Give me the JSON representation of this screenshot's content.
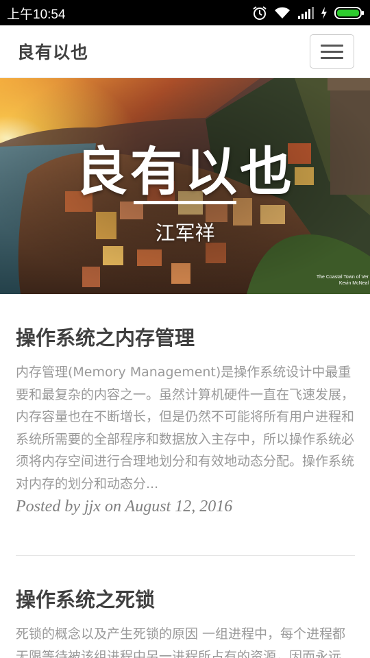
{
  "status_bar": {
    "time": "上午10:54",
    "icons": [
      "alarm-icon",
      "wifi-icon",
      "signal-icon",
      "charging-icon",
      "battery-icon"
    ],
    "battery_color": "#2ecc2e"
  },
  "navbar": {
    "brand": "良有以也",
    "menu_icon": "hamburger-icon"
  },
  "hero": {
    "title": "良有以也",
    "subtitle": "江军祥",
    "credit_line1": "The Coastal Town of Ver",
    "credit_line2": "Kevin McNeal"
  },
  "posts": [
    {
      "title": "操作系统之内存管理",
      "excerpt": "内存管理(Memory Management)是操作系统设计中最重要和最复杂的内容之一。虽然计算机硬件一直在飞速发展，内存容量也在不断增长，但是仍然不可能将所有用户进程和系统所需要的全部程序和数据放入主存中，所以操作系统必须将内存空间进行合理地划分和有效地动态分配。操作系统对内存的划分和动态分...",
      "meta": "Posted by jjx on August 12, 2016"
    },
    {
      "title": "操作系统之死锁",
      "excerpt": "死锁的概念以及产生死锁的原因 一组进程中，每个进程都无限等待被该组进程中另一进程所占有的资源，因而永远"
    }
  ]
}
